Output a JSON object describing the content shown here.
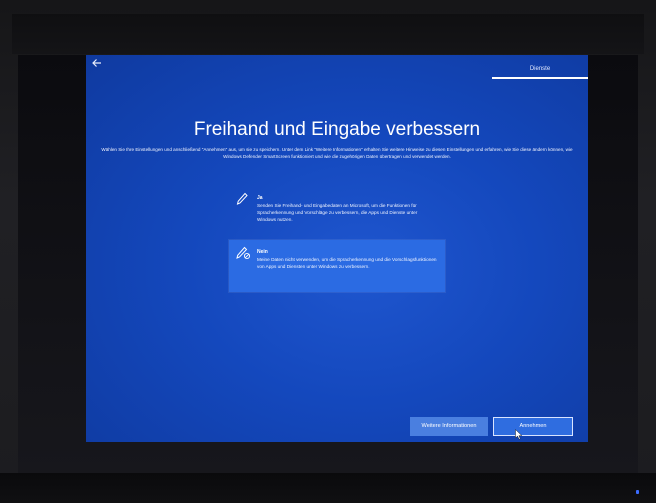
{
  "header": {
    "back_icon": "back-arrow-icon",
    "step_tab_label": "Dienste"
  },
  "page": {
    "title": "Freihand und Eingabe verbessern",
    "description": "Wählen Sie Ihre Einstellungen und anschließend \"Annehmen\" aus, um sie zu speichern. Unter dem Link \"Weitere Informationen\" erhalten Sie weitere Hinweise zu diesen Einstellungen und erfahren, wie Sie diese ändern können, wie Windows Defender SmartScreen funktioniert und wie die zugehörigen Daten übertragen und verwendet werden."
  },
  "options": [
    {
      "icon": "pen-icon",
      "title": "Ja",
      "text": "Senden Sie Freihand- und Eingabedaten an Microsoft, um die Funktionen für Spracherkennung und Vorschläge zu verbessern, die Apps und Dienste unter Windows nutzen.",
      "selected": false
    },
    {
      "icon": "pen-off-icon",
      "title": "Nein",
      "text": "Meine Daten nicht verwenden, um die Spracherkennung und die Vorschlagsfunktionen von Apps und Diensten unter Windows zu verbessern.",
      "selected": true
    }
  ],
  "buttons": {
    "more_info_label": "Weitere Informationen",
    "accept_label": "Annehmen"
  },
  "colors": {
    "background_blue": "#1448bd",
    "selected_option": "#2b6be3",
    "button_secondary": "#4a7fe0",
    "button_primary": "#2f6de0"
  }
}
